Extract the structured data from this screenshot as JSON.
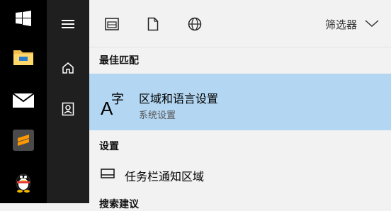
{
  "taskbar": {
    "items": [
      {
        "icon": "windows-logo-icon"
      },
      {
        "icon": "file-explorer-icon"
      },
      {
        "icon": "mail-icon"
      },
      {
        "icon": "sublime-text-icon"
      },
      {
        "icon": "qq-penguin-icon"
      }
    ]
  },
  "rail": {
    "items": [
      {
        "icon": "hamburger-menu-icon"
      },
      {
        "icon": "home-icon"
      },
      {
        "icon": "document-portrait-icon"
      }
    ]
  },
  "filters": {
    "icons": [
      "apps-icon",
      "documents-icon",
      "web-globe-icon"
    ],
    "dropdown_label": "筛选器"
  },
  "results": {
    "best_match_heading": "最佳匹配",
    "best_match": {
      "title": "区域和语言设置",
      "subtitle": "系统设置",
      "icon_text_a": "A",
      "icon_text_zi": "字"
    },
    "settings_heading": "设置",
    "settings_items": [
      {
        "label": "任务栏通知区域"
      }
    ],
    "suggestions_heading": "搜索建议"
  },
  "colors": {
    "taskbar_bg": "#000000",
    "rail_bg": "#1f1f1f",
    "panel_bg": "#f2f2f2",
    "selection_bg": "#b3d6f2"
  }
}
